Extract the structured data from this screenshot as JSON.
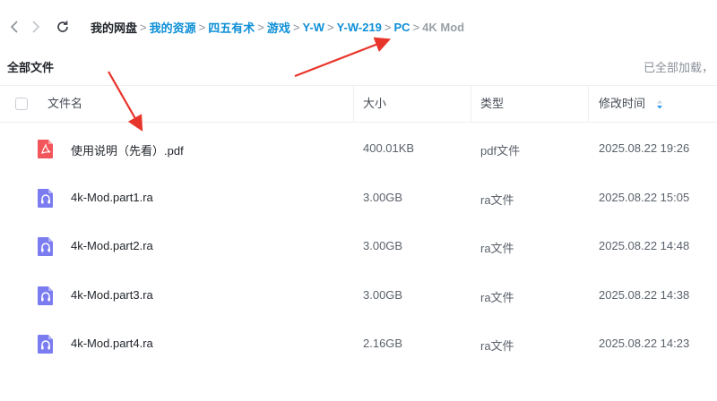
{
  "nav": {
    "back_icon": "chevron-left-icon",
    "forward_icon": "chevron-right-icon",
    "refresh_icon": "refresh-icon"
  },
  "breadcrumb": {
    "root": "我的网盘",
    "items": [
      "我的资源",
      "四五有术",
      "游戏",
      "Y-W",
      "Y-W-219",
      "PC"
    ],
    "current": "4K Mod",
    "separator": ">"
  },
  "section": {
    "title": "全部文件",
    "load_status": "已全部加载，"
  },
  "table": {
    "headers": {
      "name": "文件名",
      "size": "大小",
      "type": "类型",
      "modified": "修改时间"
    },
    "sort_icon": "sort-desc-icon",
    "rows": [
      {
        "name": "使用说明（先看）.pdf",
        "size": "400.01KB",
        "type": "pdf文件",
        "modified": "2025.08.22 19:26",
        "icon": "pdf-file-icon"
      },
      {
        "name": "4k-Mod.part1.ra",
        "size": "3.00GB",
        "type": "ra文件",
        "modified": "2025.08.22 15:05",
        "icon": "audio-file-icon"
      },
      {
        "name": "4k-Mod.part2.ra",
        "size": "3.00GB",
        "type": "ra文件",
        "modified": "2025.08.22 14:48",
        "icon": "audio-file-icon"
      },
      {
        "name": "4k-Mod.part3.ra",
        "size": "3.00GB",
        "type": "ra文件",
        "modified": "2025.08.22 14:38",
        "icon": "audio-file-icon"
      },
      {
        "name": "4k-Mod.part4.ra",
        "size": "2.16GB",
        "type": "ra文件",
        "modified": "2025.08.22 14:23",
        "icon": "audio-file-icon"
      }
    ]
  },
  "colors": {
    "link": "#0d8fd6",
    "pdf_icon": "#f2555a",
    "audio_icon": "#7b7cf0",
    "annotation_arrow": "#e8352b"
  }
}
